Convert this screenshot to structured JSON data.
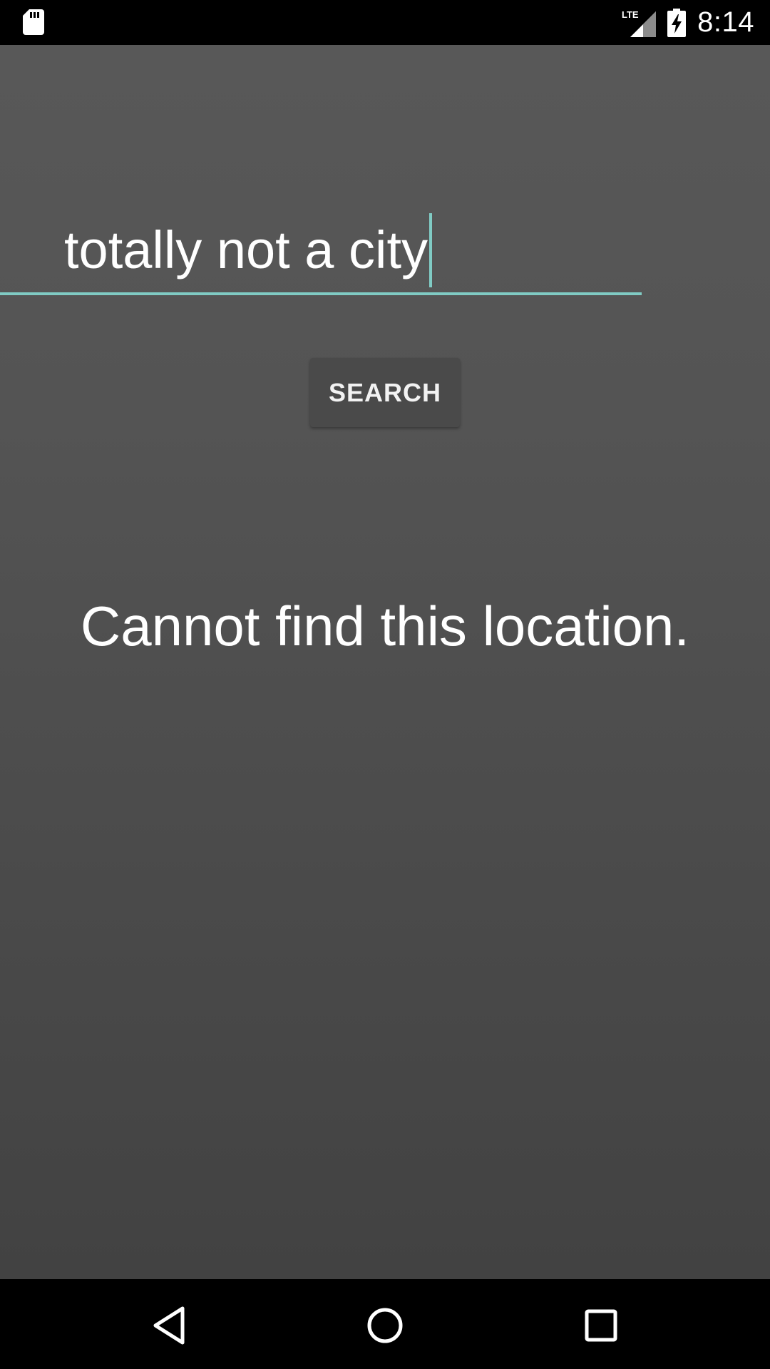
{
  "status_bar": {
    "network_label": "LTE",
    "time": "8:14",
    "icons": [
      "sd-card-icon",
      "lte-signal-icon",
      "battery-charging-icon"
    ]
  },
  "search": {
    "value": "totally not a city",
    "button_label": "SEARCH"
  },
  "result": {
    "message": "Cannot find this location."
  },
  "nav_bar": {
    "icons": [
      "back-icon",
      "home-icon",
      "recents-icon"
    ]
  },
  "colors": {
    "accent": "#80cbc4",
    "background_top": "#585858",
    "background_bottom": "#424242",
    "button": "#4a4a4a"
  }
}
